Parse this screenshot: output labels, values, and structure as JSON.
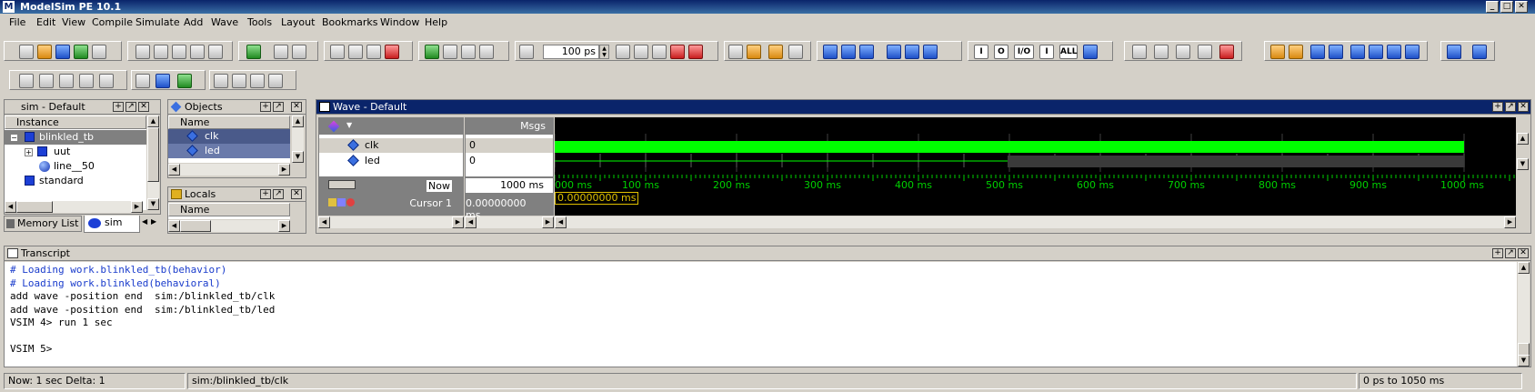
{
  "app": {
    "title": "ModelSim PE 10.1"
  },
  "menu": [
    "File",
    "Edit",
    "View",
    "Compile",
    "Simulate",
    "Add",
    "Wave",
    "Tools",
    "Layout",
    "Bookmarks",
    "Window",
    "Help"
  ],
  "toolbar": {
    "run_length": "100 ps"
  },
  "sim_pane": {
    "title": "sim - Default",
    "column": "Instance",
    "items": [
      {
        "label": "blinkled_tb",
        "icon": "instance-icon"
      },
      {
        "label": "uut",
        "icon": "instance-icon"
      },
      {
        "label": "line__50",
        "icon": "process-icon"
      },
      {
        "label": "standard",
        "icon": "package-icon"
      }
    ]
  },
  "objects_pane": {
    "title": "Objects",
    "column": "Name",
    "items": [
      "clk",
      "led"
    ]
  },
  "locals_pane": {
    "title": "Locals",
    "column": "Name"
  },
  "tabs": [
    "Memory List",
    "sim"
  ],
  "wave": {
    "title": "Wave - Default",
    "msgs_label": "Msgs",
    "signals": [
      {
        "name": "clk",
        "value": "0"
      },
      {
        "name": "led",
        "value": "0"
      }
    ],
    "now_label": "Now",
    "now_value": "1000 ms",
    "cursor_label": "Cursor 1",
    "cursor_value": "0.00000000 ms",
    "cursor_marker": "0.00000000 ms",
    "timeline": [
      "000 ms",
      "100 ms",
      "200 ms",
      "300 ms",
      "400 ms",
      "500 ms",
      "600 ms",
      "700 ms",
      "800 ms",
      "900 ms",
      "1000 ms"
    ],
    "wave_color": "#00ff00"
  },
  "transcript": {
    "title": "Transcript",
    "lines": [
      {
        "text": "# Loading work.blinkled_tb(behavior)",
        "color": "#1a3ccc"
      },
      {
        "text": "# Loading work.blinkled(behavioral)",
        "color": "#1a3ccc"
      },
      {
        "text": "add wave -position end  sim:/blinkled_tb/clk",
        "color": "#000000"
      },
      {
        "text": "add wave -position end  sim:/blinkled_tb/led",
        "color": "#000000"
      },
      {
        "text": "VSIM 4> run 1 sec",
        "color": "#000000"
      },
      {
        "text": "",
        "color": "#000000"
      },
      {
        "text": "VSIM 5>",
        "color": "#000000"
      }
    ]
  },
  "status": {
    "now": "Now: 1 sec  Delta: 1",
    "path": "sim:/blinkled_tb/clk",
    "range": "0 ps to 1050 ms"
  }
}
